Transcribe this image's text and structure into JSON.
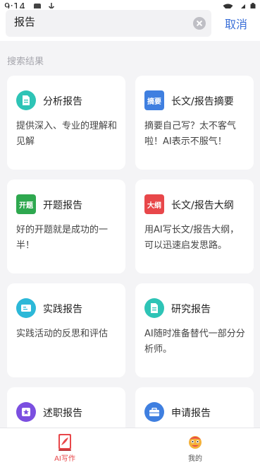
{
  "status_bar": {
    "time": "9:14"
  },
  "search": {
    "query": "报告",
    "cancel_label": "取消"
  },
  "section_label": "搜索结果",
  "cards": [
    {
      "title": "分析报告",
      "desc": "提供深入、专业的理解和见解",
      "icon": "document-icon",
      "icon_text": "",
      "color": "#2ec4b6"
    },
    {
      "title": "长文/报告摘要",
      "desc": "摘要自己写？太不客气啦！AI表示不服气！",
      "icon": "summary-badge-icon",
      "icon_text": "摘要",
      "color": "#3f7fe0"
    },
    {
      "title": "开题报告",
      "desc": "好的开题就是成功的一半！",
      "icon": "proposal-badge-icon",
      "icon_text": "开题",
      "color": "#2ea84f"
    },
    {
      "title": "长文/报告大纲",
      "desc": "用AI写长文/报告大纲，可以迅速启发思路。",
      "icon": "outline-badge-icon",
      "icon_text": "大纲",
      "color": "#e8474a"
    },
    {
      "title": "实践报告",
      "desc": "实践活动的反思和评估",
      "icon": "practice-icon",
      "icon_text": "",
      "color": "#2cb8d8"
    },
    {
      "title": "研究报告",
      "desc": "AI随时准备替代一部分分析师。",
      "icon": "research-document-icon",
      "icon_text": "",
      "color": "#2ec4b6"
    },
    {
      "title": "述职报告",
      "desc": "",
      "icon": "star-badge-icon",
      "icon_text": "",
      "color": "#7b4fe0"
    },
    {
      "title": "申请报告",
      "desc": "",
      "icon": "briefcase-icon",
      "icon_text": "",
      "color": "#3f7fe0"
    }
  ],
  "tabs": [
    {
      "label": "AI写作",
      "icon": "ai-writing-icon",
      "active": true,
      "color": "#e8474a"
    },
    {
      "label": "我的",
      "icon": "profile-mascot-icon",
      "active": false,
      "color": "#555555"
    }
  ]
}
